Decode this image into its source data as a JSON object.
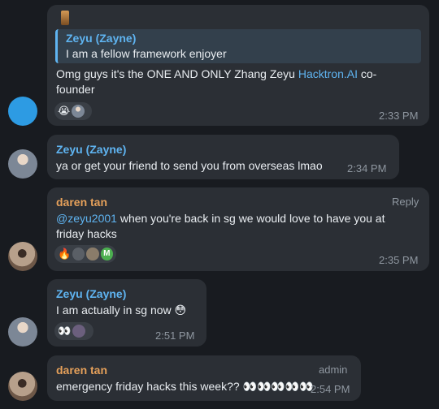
{
  "messages": [
    {
      "reply": {
        "sender": "Zeyu (Zayne)",
        "text": "I am a fellow framework enjoyer"
      },
      "line1": "Omg guys it's the ONE AND ONLY Zhang Zeyu ",
      "link": "Hacktron.AI",
      "line1_end": " co-",
      "line2": "founder",
      "reactions": "😭",
      "time": "2:33 PM"
    },
    {
      "sender": "Zeyu (Zayne)",
      "text": "ya or get your friend to send you from overseas lmao",
      "time": "2:34 PM"
    },
    {
      "sender": "daren tan",
      "side_label": "Reply",
      "mention": "@zeyu2001",
      "line1": " when you're back in sg we would love to have you at",
      "line2": "friday hacks",
      "reactions": "🔥",
      "reaction_initial": "M",
      "time": "2:35 PM"
    },
    {
      "sender": "Zeyu (Zayne)",
      "text": "I am actually in sg now 😳",
      "reactions": "👀",
      "time": "2:51 PM"
    },
    {
      "sender": "daren tan",
      "side_label": "admin",
      "text": "emergency friday hacks this week?? 👀👀👀👀👀",
      "time": "2:54 PM"
    }
  ],
  "colors": {
    "background": "#181b20",
    "bubble": "#2b2f35",
    "accent_blue": "#5fb4f1",
    "accent_orange": "#e5a05a",
    "muted": "#8f97a0"
  }
}
